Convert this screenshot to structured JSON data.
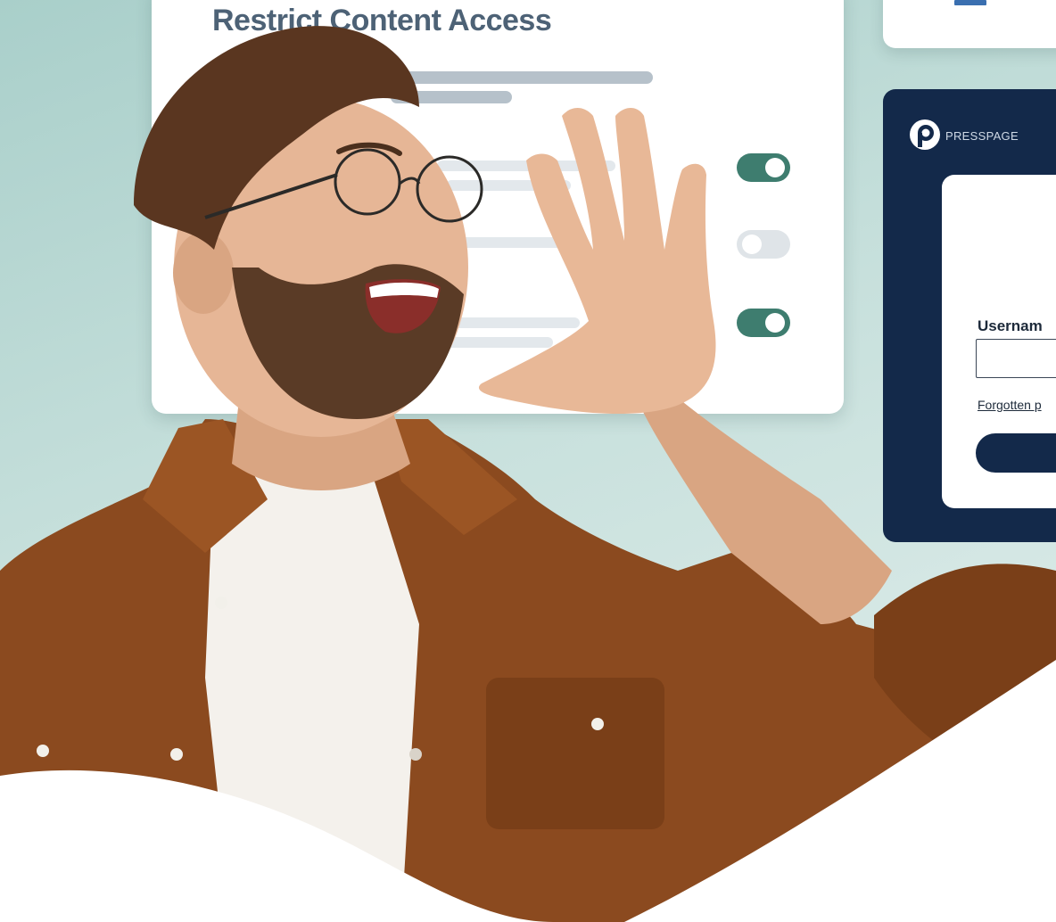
{
  "restrict_card": {
    "title": "Restrict Content Access",
    "toggles": [
      {
        "state": "on"
      },
      {
        "state": "off"
      },
      {
        "state": "on"
      }
    ]
  },
  "login_panel": {
    "brand": "PRESSPAGE",
    "username_label": "Usernam",
    "forgot_link": "Forgotten p"
  },
  "colors": {
    "toggle_on": "#3e7d6f",
    "toggle_off": "#dfe4e8",
    "panel_navy": "#13294a",
    "title_slate": "#4d6276",
    "background_mint": "#a9cfca"
  },
  "icons": {
    "logo": "presspage-logo-icon"
  }
}
